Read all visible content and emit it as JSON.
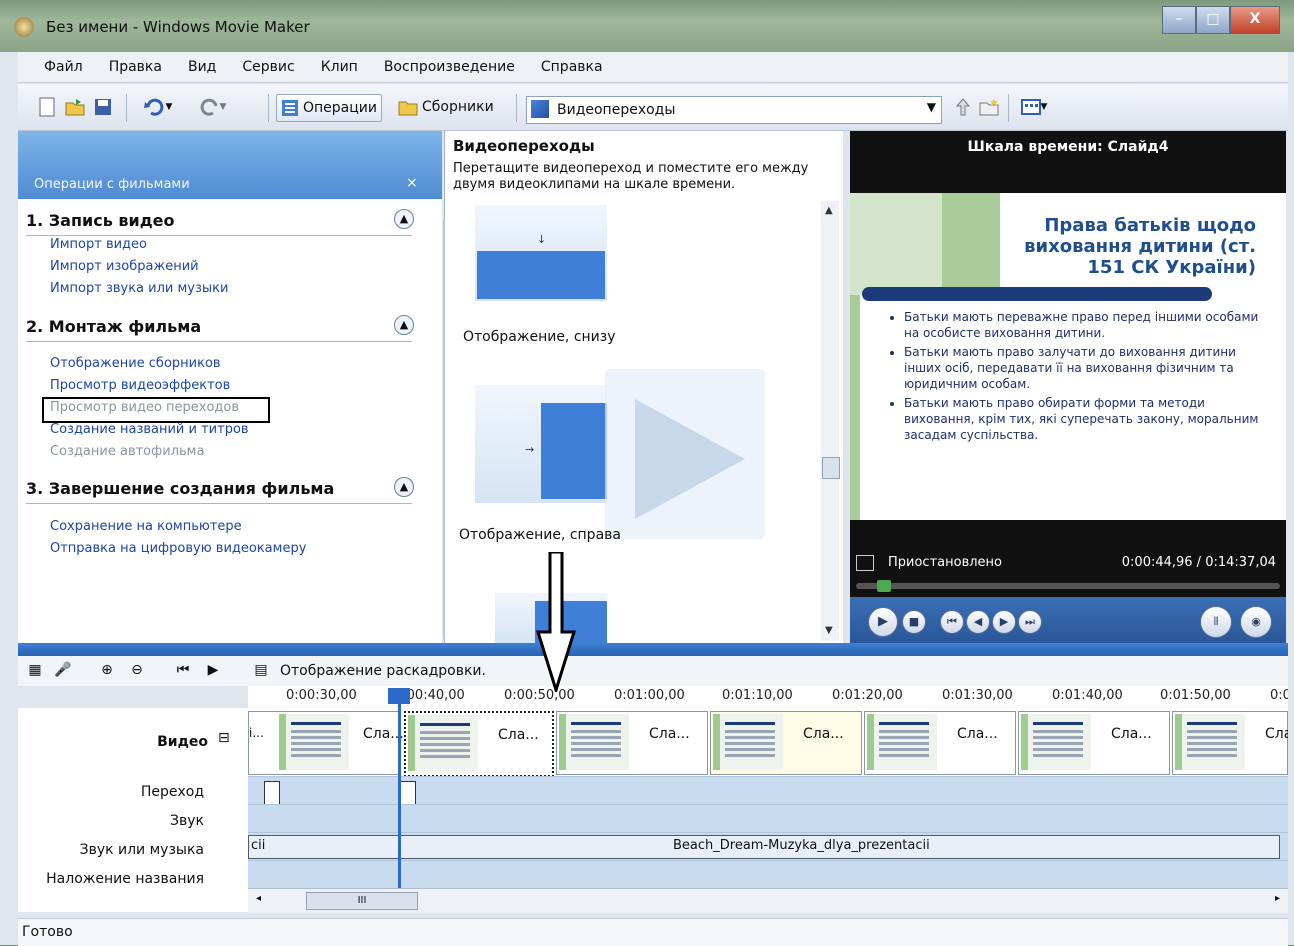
{
  "window": {
    "title": "Без имени - Windows Movie Maker",
    "minimize": "–",
    "maximize": "□",
    "close": "X"
  },
  "menu": [
    "Файл",
    "Правка",
    "Вид",
    "Сервис",
    "Клип",
    "Воспроизведение",
    "Справка"
  ],
  "toolbar": {
    "operations": "Операции",
    "collections": "Сборники",
    "collection_select": "Видеопереходы",
    "icons": [
      "new-icon",
      "open-icon",
      "save-icon",
      "undo-icon",
      "redo-icon",
      "up-folder-icon",
      "new-folder-icon",
      "view-icon"
    ]
  },
  "tasks": {
    "header": "Операции с фильмами",
    "close": "×",
    "sections": [
      {
        "title": "1. Запись видео",
        "links": [
          "Импорт видео",
          "Импорт изображений",
          "Импорт звука или музыки"
        ]
      },
      {
        "title": "2. Монтаж фильма",
        "links": [
          "Отображение сборников",
          "Просмотр видеоэффектов",
          "Просмотр видео переходов",
          "Создание названий и титров",
          "Создание автофильма"
        ]
      },
      {
        "title": "3. Завершение создания фильма",
        "links": [
          "Сохранение на компьютере",
          "Отправка на цифровую видеокамеру"
        ]
      }
    ]
  },
  "collection": {
    "title": "Видеопереходы",
    "description": "Перетащите видеопереход и поместите его между двумя видеоклипами на шкале времени.",
    "items": [
      "Отображение, снизу",
      "Отображение, справа"
    ]
  },
  "preview": {
    "title": "Шкала времени: Слайд4",
    "slide_title": "Права батьків щодо виховання дитини (ст. 151 СК України)",
    "bullets": [
      "Батьки мають переважне право перед іншими особами на особисте виховання дитини.",
      "Батьки мають право залучати до виховання дитини інших осіб, передавати її на виховання фізичним та юридичним особам.",
      "Батьки мають право обирати форми та методи виховання, крім тих, які суперечать закону, моральним засадам суспільства."
    ],
    "status": "Приостановлено",
    "time": "0:00:44,96 / 0:14:37,04",
    "progress_fraction": 0.05
  },
  "timeline": {
    "toggle_label": "Отображение раскадровки.",
    "ruler": [
      "0:00:30,00",
      "0:00:40,00",
      "0:00:50,00",
      "0:01:00,00",
      "0:01:10,00",
      "0:01:20,00",
      "0:01:30,00",
      "0:01:40,00",
      "0:01:50,00",
      "0:0"
    ],
    "tracks": {
      "video": "Видео",
      "video_toggle": "⊟",
      "transition": "Переход",
      "sound": "Звук",
      "music": "Звук или музыка",
      "title_overlay": "Наложение названия"
    },
    "clips": [
      "i...",
      "Сла...",
      "Сла...",
      "Сла...",
      "Сла...",
      "Сла...",
      "Сла...",
      "Сла..."
    ],
    "music_clip": "Beach_Dream-Muzyka_dlya_prezentacii",
    "music_clip_prefix": "cii",
    "scroll_left": "◂",
    "scroll_thumb": "III",
    "scroll_right": "▸"
  },
  "statusbar": {
    "text": "Готово"
  }
}
